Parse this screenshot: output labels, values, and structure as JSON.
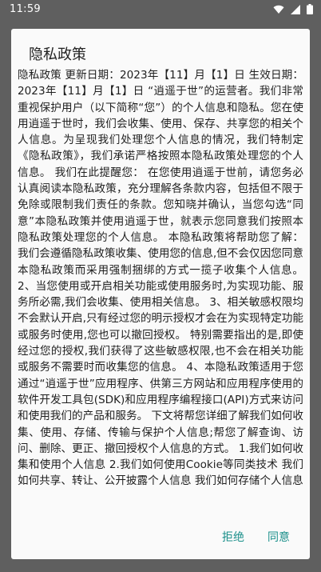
{
  "status_bar": {
    "time": "11:59",
    "icons": [
      "wifi-icon",
      "cellular-signal-icon",
      "battery-icon"
    ]
  },
  "dialog": {
    "title": "隐私政策",
    "body": "隐私政策 更新日期：2023年【11】月【1】日 生效日期：2023年【11】月【1】日 “逍遥于世”的运营者。我们非常重视保护用户（以下简称“您”）的个人信息和隐私。您在使用逍遥于世时，我们会收集、使用、保存、共享您的相关个人信息。为呈现我们处理您个人信息的情况，我们特制定《隐私政策》，我们承诺严格按照本隐私政策处理您的个人信息。 我们在此提醒您： 在您使用逍遥于世前，请您务必认真阅读本隐私政策，充分理解各条款内容，包括但不限于免除或限制我们责任的条款。您知晓并确认，当您勾选“同意”本隐私政策并使用逍遥于世，就表示您同意我们按照本隐私政策处理您的个人信息。 本隐私政策将帮助您了解： 我们会遵循隐私政策收集、使用您的信息,但不会仅因您同意本隐私政策而采用强制捆绑的方式一揽子收集个人信息。 2、当您使用或开启相关功能或使用服务时,为实现功能、服务所必需,我们会收集、使用相关信息。 3、相关敏感权限均不会默认开启,只有经过您的明示授权才会在为实现特定功能或服务时使用,您也可以撤回授权。 特别需要指出的是,即使经过您的授权,我们获得了这些敏感权限,也不会在相关功能或服务不需要时而收集您的信息。 4、本隐私政策适用于您通过“逍遥于世”应用程序、供第三方网站和应用程序使用的软件开发工具包(SDK)和应用程序编程接口(API)方式来访问和使用我们的产品和服务。 下文将帮您详细了解我们如何收集、使用、存储、传输与保护个人信息;帮您了解查询、访问、删除、更正、撤回授权个人信息的方式。 1.我们如何收集和使用个人信息 2.我们如何使用Cookie等同类技术 我们如何共享、转让、公开披露个人信息 我们如何存储个人信息",
    "reject_label": "拒绝",
    "agree_label": "同意"
  },
  "colors": {
    "scrim": "#5f5f5f",
    "dialog_bg": "#fafafa",
    "accent": "#1a8f8a"
  }
}
